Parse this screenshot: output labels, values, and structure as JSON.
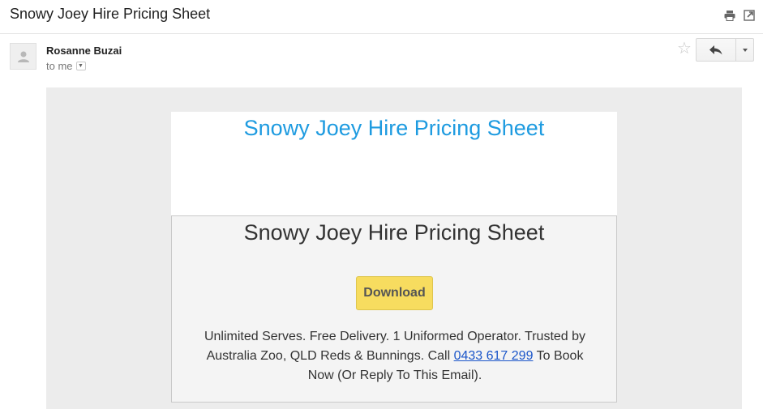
{
  "subject": "Snowy Joey Hire Pricing Sheet",
  "toolbar": {
    "print_icon": "print-icon",
    "new_window_icon": "open-in-new-window-icon"
  },
  "message": {
    "sender": "Rosanne Buzai",
    "recipient": "to me",
    "star_icon": "star-icon",
    "reply_icon": "reply-icon",
    "more_icon": "more-actions-icon"
  },
  "email_body": {
    "header_title": "Snowy Joey Hire Pricing Sheet",
    "card_title": "Snowy Joey Hire Pricing Sheet",
    "download_label": "Download",
    "body_text_before": "Unlimited Serves. Free Delivery. 1 Uniformed Operator. Trusted by Australia Zoo, QLD Reds & Bunnings. Call ",
    "phone": "0433 617 299",
    "body_text_after": " To Book Now (Or Reply To This Email)."
  },
  "colors": {
    "title_blue": "#1e9be0",
    "button_yellow": "#f7dc5f",
    "link_blue": "#1a55c9"
  }
}
